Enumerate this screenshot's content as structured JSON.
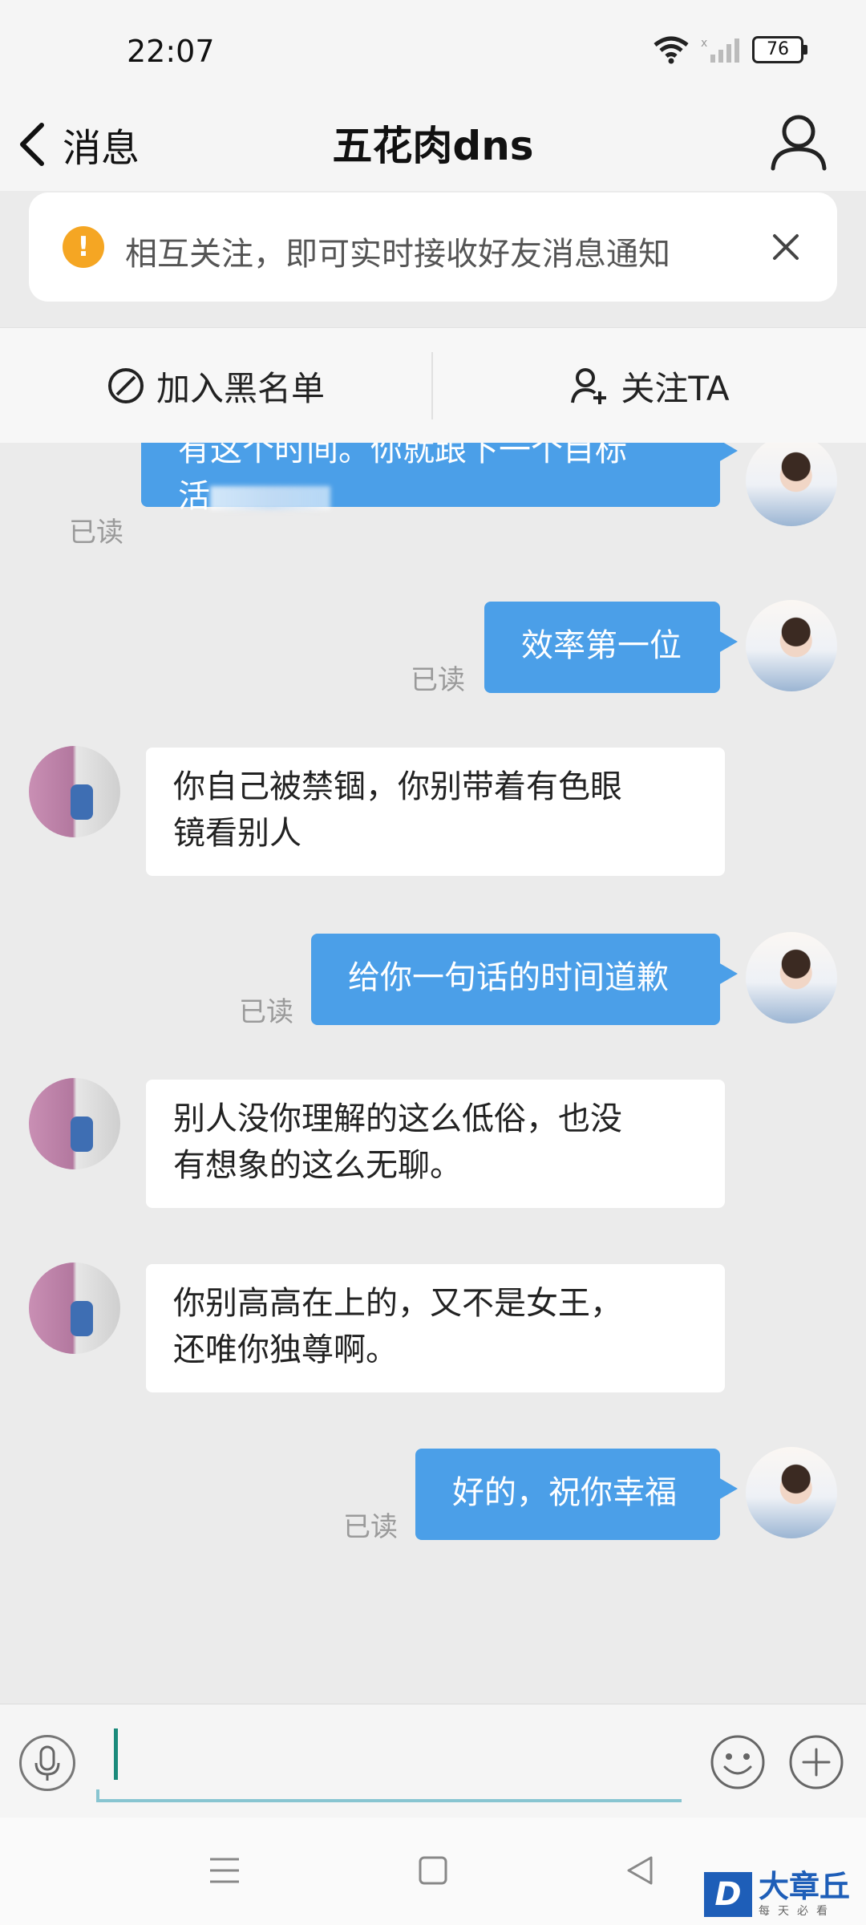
{
  "status_bar": {
    "time": "22:07",
    "battery": "76"
  },
  "header": {
    "back_label": "消息",
    "title": "五花肉dns"
  },
  "notice": {
    "text": "相互关注，即可实时接收好友消息通知"
  },
  "actions": {
    "block_label": "加入黑名单",
    "follow_label": "关注TA"
  },
  "messages": [
    {
      "side": "sent",
      "lines": [
        "有这个时间。你就跟下一个目标",
        "活"
      ],
      "read": "已读"
    },
    {
      "side": "sent",
      "lines": [
        "效率第一位"
      ],
      "read": "已读"
    },
    {
      "side": "received",
      "lines": [
        "你自己被禁锢，你别带着有色眼",
        "镜看别人"
      ]
    },
    {
      "side": "sent",
      "lines": [
        "给你一句话的时间道歉"
      ],
      "read": "已读"
    },
    {
      "side": "received",
      "lines": [
        "别人没你理解的这么低俗，也没",
        "有想象的这么无聊。"
      ]
    },
    {
      "side": "received",
      "lines": [
        "你别高高在上的，又不是女王，",
        "还唯你独尊啊。"
      ]
    },
    {
      "side": "sent",
      "lines": [
        "好的，祝你幸福"
      ],
      "read": "已读"
    }
  ],
  "input": {
    "value": ""
  },
  "watermark": {
    "title": "大章丘",
    "subtitle": "每天必看",
    "logo": "D"
  },
  "colors": {
    "sent_bubble": "#4b9fe8",
    "received_bubble": "#ffffff",
    "notice_icon": "#f5a623"
  },
  "icons": [
    "wifi-icon",
    "signal-icon",
    "battery-icon",
    "back-chevron-icon",
    "profile-icon",
    "warning-icon",
    "close-icon",
    "block-icon",
    "add-user-icon",
    "microphone-icon",
    "emoji-icon",
    "plus-icon",
    "menu-icon",
    "home-icon",
    "back-triangle-icon"
  ]
}
